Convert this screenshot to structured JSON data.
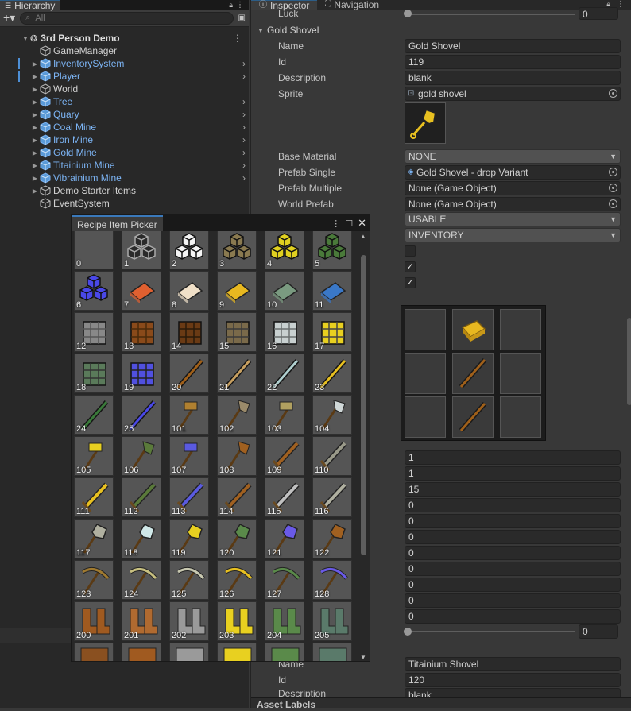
{
  "hierarchy": {
    "tab_label": "Hierarchy",
    "search_placeholder": "All",
    "scene_name": "3rd Person Demo",
    "items": [
      {
        "label": "GameManager",
        "prefab": false,
        "expandable": false,
        "chevron": false
      },
      {
        "label": "InventorySystem",
        "prefab": true,
        "expandable": true,
        "chevron": true
      },
      {
        "label": "Player",
        "prefab": true,
        "expandable": true,
        "chevron": true
      },
      {
        "label": "World",
        "prefab": false,
        "expandable": true,
        "chevron": false
      },
      {
        "label": "Tree",
        "prefab": true,
        "expandable": true,
        "chevron": true
      },
      {
        "label": "Quary",
        "prefab": true,
        "expandable": true,
        "chevron": true
      },
      {
        "label": "Coal Mine",
        "prefab": true,
        "expandable": true,
        "chevron": true
      },
      {
        "label": "Iron Mine",
        "prefab": true,
        "expandable": true,
        "chevron": true
      },
      {
        "label": "Gold Mine",
        "prefab": true,
        "expandable": true,
        "chevron": true
      },
      {
        "label": "Titainium Mine",
        "prefab": true,
        "expandable": true,
        "chevron": true
      },
      {
        "label": "Vibrainium Mine",
        "prefab": true,
        "expandable": true,
        "chevron": true
      },
      {
        "label": "Demo Starter Items",
        "prefab": false,
        "expandable": true,
        "chevron": false
      },
      {
        "label": "EventSystem",
        "prefab": false,
        "expandable": false,
        "chevron": false
      }
    ]
  },
  "inspector": {
    "tab_inspector": "Inspector",
    "tab_navigation": "Navigation",
    "luck_label": "Luck",
    "luck_value": "0",
    "section_title": "Gold Shovel",
    "fields": {
      "name_label": "Name",
      "name_value": "Gold Shovel",
      "id_label": "Id",
      "id_value": "119",
      "desc_label": "Description",
      "desc_value": "blank",
      "sprite_label": "Sprite",
      "sprite_value": "gold shovel",
      "base_material_label": "Base Material",
      "base_material_value": "NONE",
      "prefab_single_label": "Prefab Single",
      "prefab_single_value": "Gold Shovel - drop Variant",
      "prefab_multiple_label": "Prefab Multiple",
      "prefab_multiple_value": "None (Game Object)",
      "world_prefab_label": "World Prefab",
      "world_prefab_value": "None (Game Object)"
    },
    "dropdown_usable": "USABLE",
    "dropdown_inventory": "INVENTORY",
    "checkboxes": [
      false,
      true,
      true
    ],
    "numbers": [
      "1",
      "1",
      "15",
      "0",
      "0",
      "0",
      "0",
      "0",
      "0",
      "0",
      "0"
    ],
    "bottom_slider_value": "0",
    "next_item": {
      "name_label": "Name",
      "name_value": "Titainium Shovel",
      "id_label": "Id",
      "id_value": "120",
      "desc_label": "Description",
      "desc_value": "blank"
    },
    "asset_labels": "Asset Labels"
  },
  "picker": {
    "title": "Recipe Item Picker",
    "items": [
      "0",
      "1",
      "2",
      "3",
      "4",
      "5",
      "6",
      "7",
      "8",
      "9",
      "10",
      "11",
      "12",
      "13",
      "14",
      "15",
      "16",
      "17",
      "18",
      "19",
      "20",
      "21",
      "22",
      "23",
      "24",
      "25",
      "101",
      "102",
      "103",
      "104",
      "105",
      "106",
      "107",
      "108",
      "109",
      "110",
      "111",
      "112",
      "113",
      "114",
      "115",
      "116",
      "117",
      "118",
      "119",
      "120",
      "121",
      "122",
      "123",
      "124",
      "125",
      "126",
      "127",
      "128",
      "200",
      "201",
      "202",
      "203",
      "204",
      "205",
      "",
      "",
      "",
      "",
      "",
      ""
    ],
    "colors": {
      "cube": [
        "none",
        "#2a2a2a",
        "#f0f0f0",
        "#8a7a50",
        "#e0d020",
        "#4a7a3a",
        "#4a48e8"
      ],
      "ingot": [
        "#e06030",
        "#f0e0c8",
        "#e8b820",
        "#7a9a80",
        "#3a78c8"
      ]
    }
  },
  "colors": {
    "accent_blue": "#7cb4f4",
    "gold": "#e8c020"
  }
}
